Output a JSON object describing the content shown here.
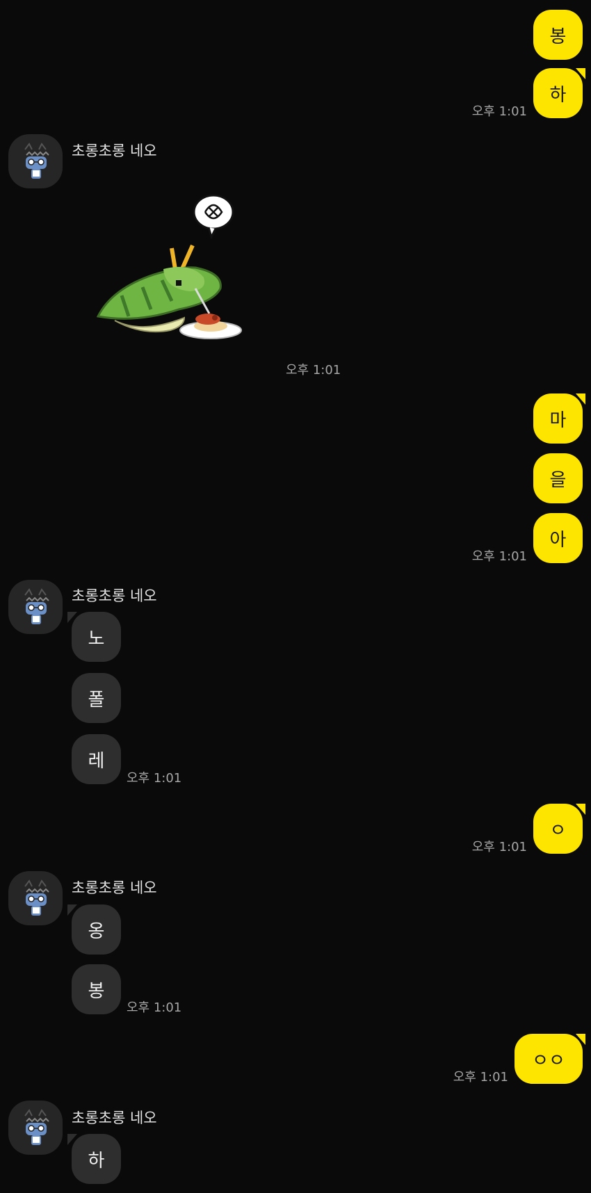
{
  "partner": {
    "name": "초롱초롱 네오",
    "avatar_icon": "neo-character-icon"
  },
  "messages": {
    "m1": {
      "text": "봉"
    },
    "m2": {
      "text": "하",
      "time": "오후 1:01"
    },
    "g1": {
      "sticker_icon": "caterpillar-spaghetti-sticker-icon",
      "time": "오후 1:01"
    },
    "m3": {
      "text": "마"
    },
    "m4": {
      "text": "을"
    },
    "m5": {
      "text": "아",
      "time": "오후 1:01"
    },
    "g2a": {
      "text": "노"
    },
    "g2b": {
      "text": "폴"
    },
    "g2c": {
      "text": "레",
      "time": "오후 1:01"
    },
    "m6": {
      "text": "ㅇ",
      "time": "오후 1:01"
    },
    "g3a": {
      "text": "옹"
    },
    "g3b": {
      "text": "봉",
      "time": "오후 1:01"
    },
    "m7": {
      "text": "ㅇㅇ",
      "time": "오후 1:01"
    },
    "g4a": {
      "text": "하"
    }
  },
  "colors": {
    "my_bubble": "#fee500",
    "their_bubble": "#2e2e2e",
    "background": "#0a0a0a"
  }
}
